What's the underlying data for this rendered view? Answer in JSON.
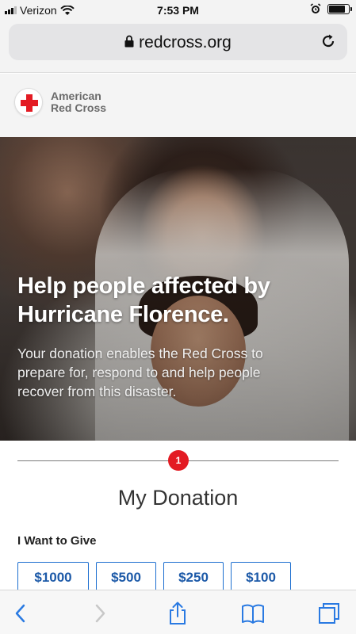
{
  "status_bar": {
    "carrier": "Verizon",
    "time": "7:53 PM"
  },
  "browser": {
    "url": "redcross.org"
  },
  "site": {
    "logo_line1": "American",
    "logo_line2": "Red Cross"
  },
  "hero": {
    "headline_line1": "Help people affected by",
    "headline_line2": "Hurricane Florence.",
    "subtext_line1": "Your donation enables the Red Cross to",
    "subtext_line2": "prepare for, respond to and help people",
    "subtext_line3": "recover from this disaster."
  },
  "donation": {
    "step_number": "1",
    "title": "My Donation",
    "give_label": "I Want to Give",
    "amounts": [
      "$1000",
      "$500",
      "$250",
      "$100"
    ]
  },
  "colors": {
    "brand_red": "#e31b23",
    "button_blue": "#1d6fd0",
    "toolbar_blue": "#2a7ae2"
  },
  "icons": {
    "back": "chevron-left-icon",
    "forward": "chevron-right-icon",
    "share": "share-icon",
    "bookmarks": "book-icon",
    "tabs": "tabs-icon"
  }
}
